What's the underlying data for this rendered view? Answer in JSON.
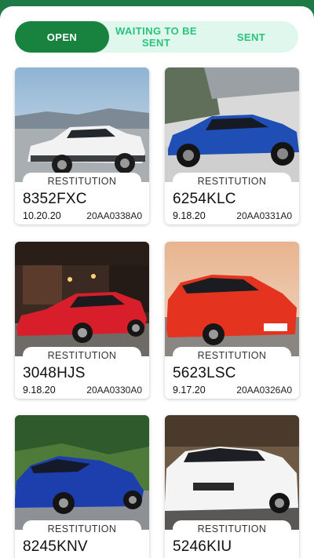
{
  "tabs": {
    "open": "OPEN",
    "waiting": "WAITING TO BE SENT",
    "sent": "SENT"
  },
  "colors": {
    "header": "#1e7a45",
    "active_tab": "#18833f",
    "inactive_tab_text": "#27c47c",
    "tab_track": "#dff7ec"
  },
  "cards": [
    {
      "status": "RESTITUTION",
      "plate": "8352FXC",
      "date": "10.20.20",
      "code": "20AA0338A0",
      "car_color": "white"
    },
    {
      "status": "RESTITUTION",
      "plate": "6254KLC",
      "date": "9.18.20",
      "code": "20AA0331A0",
      "car_color": "blue"
    },
    {
      "status": "RESTITUTION",
      "plate": "3048HJS",
      "date": "9.18.20",
      "code": "20AA0330A0",
      "car_color": "red"
    },
    {
      "status": "RESTITUTION",
      "plate": "5623LSC",
      "date": "9.17.20",
      "code": "20AA0326A0",
      "car_color": "red"
    },
    {
      "status": "RESTITUTION",
      "plate": "8245KNV",
      "date": "",
      "code": "",
      "car_color": "blue"
    },
    {
      "status": "RESTITUTION",
      "plate": "5246KIU",
      "date": "",
      "code": "",
      "car_color": "white"
    }
  ]
}
